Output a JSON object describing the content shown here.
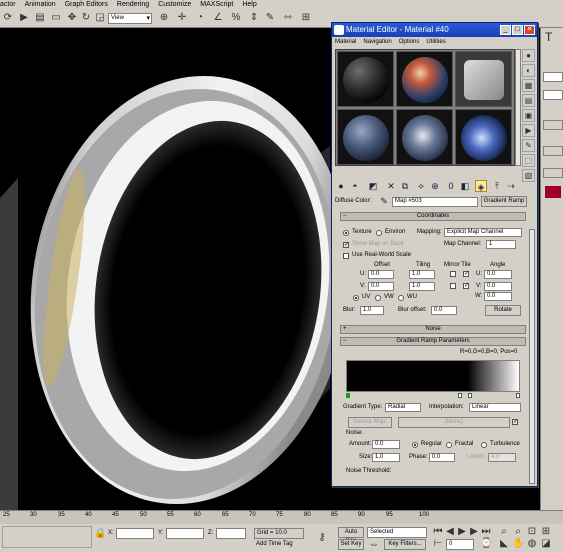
{
  "main_menu": [
    "actor",
    "Animation",
    "Graph Editors",
    "Rendering",
    "Customize",
    "MAXScript",
    "Help"
  ],
  "toolbar": {
    "view_select": "View"
  },
  "timeline": {
    "ticks": [
      "25",
      "30",
      "35",
      "40",
      "45",
      "50",
      "55",
      "60",
      "65",
      "70",
      "75",
      "80",
      "85",
      "90",
      "95",
      "100"
    ]
  },
  "status": {
    "x_label": "X:",
    "y_label": "Y:",
    "z_label": "Z:",
    "grid": "Grid = 10.0",
    "add_time_tag": "Add Time Tag",
    "auto_key": "Auto Key",
    "set_key": "Set Key",
    "selected": "Selected",
    "key_filters": "Key Filters...",
    "frame": "0"
  },
  "mat_editor": {
    "title": "Material Editor - Material #40",
    "menu": [
      "Material",
      "Navigation",
      "Options",
      "Utilities"
    ],
    "diffuse_label": "Diffuse Color:",
    "map_name": "Map #503",
    "map_type": "Gradient Ramp",
    "coordinates": {
      "header": "Coordinates",
      "texture": "Texture",
      "environ": "Environ",
      "mapping_label": "Mapping:",
      "mapping_value": "Explicit Map Channel",
      "show_map_on_back": "Show Map on Back",
      "map_channel_label": "Map Channel:",
      "map_channel_value": "1",
      "real_world": "Use Real-World Scale",
      "offset_label": "Offset",
      "tiling_label": "Tiling",
      "mirror_tile_label": "Mirror Tile",
      "angle_label": "Angle",
      "u_label": "U:",
      "v_label": "V:",
      "w_label": "W:",
      "offset_u": "0.0",
      "offset_v": "0.0",
      "tiling_u": "1.0",
      "tiling_v": "1.0",
      "angle_u": "0.0",
      "angle_v": "0.0",
      "angle_w": "0.0",
      "uv": "UV",
      "vw": "VW",
      "wu": "WU",
      "blur_label": "Blur:",
      "blur_value": "1.0",
      "blur_offset_label": "Blur offset:",
      "blur_offset_value": "0.0",
      "rotate": "Rotate"
    },
    "noise_header": "Noise",
    "gradient": {
      "header": "Gradient Ramp Parameters",
      "readout": "R=0,G=0,B=0, Pos=0",
      "type_label": "Gradient Type:",
      "type_value": "Radial",
      "interp_label": "Interpolation:",
      "interp_value": "Linear",
      "source_map_label": "Source Map:",
      "source_map_value": "(None)"
    },
    "noise": {
      "group_label": "Noise:",
      "amount_label": "Amount:",
      "amount_value": "0.0",
      "regular": "Regular",
      "fractal": "Fractal",
      "turbulence": "Turbulence",
      "size_label": "Size:",
      "size_value": "1.0",
      "phase_label": "Phase:",
      "phase_value": "0.0",
      "levels_label": "Levels:",
      "levels_value": "4.0",
      "threshold_label": "Noise Threshold:"
    }
  }
}
